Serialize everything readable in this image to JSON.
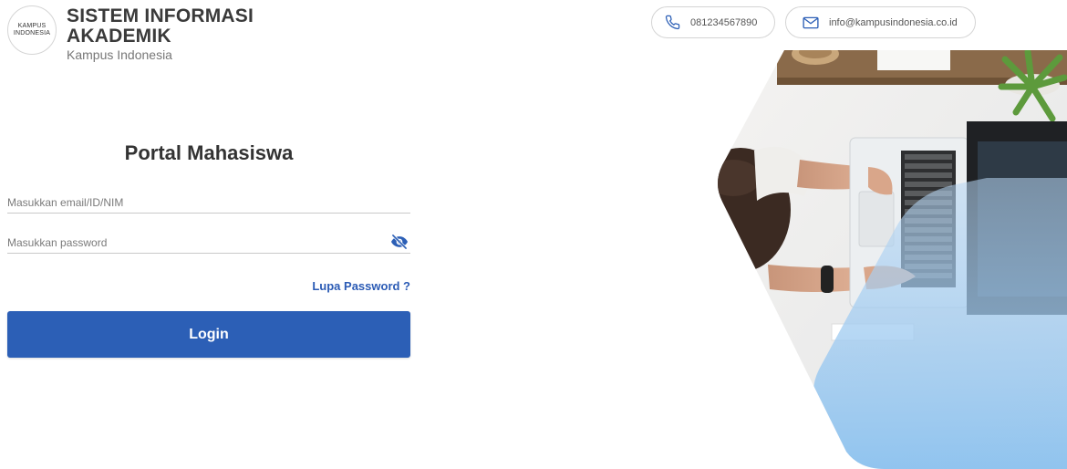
{
  "brand": {
    "logo_line1": "KAMPUS",
    "logo_line2": "INDONESIA",
    "title_line1": "SISTEM INFORMASI",
    "title_line2": "AKADEMIK",
    "subtitle": "Kampus Indonesia"
  },
  "contact": {
    "phone": "081234567890",
    "email": "info@kampusindonesia.co.id",
    "phone_icon": "phone-icon",
    "email_icon": "mail-icon"
  },
  "login": {
    "title": "Portal Mahasiswa",
    "email_placeholder": "Masukkan email/ID/NIM",
    "email_value": "",
    "password_placeholder": "Masukkan password",
    "password_value": "",
    "toggle_icon": "eye-slash-icon",
    "forgot_label": "Lupa Password ?",
    "submit_label": "Login"
  },
  "colors": {
    "primary": "#2c5fb6",
    "link": "#2b5bb5",
    "accent_overlay": "#9cc8ef"
  }
}
